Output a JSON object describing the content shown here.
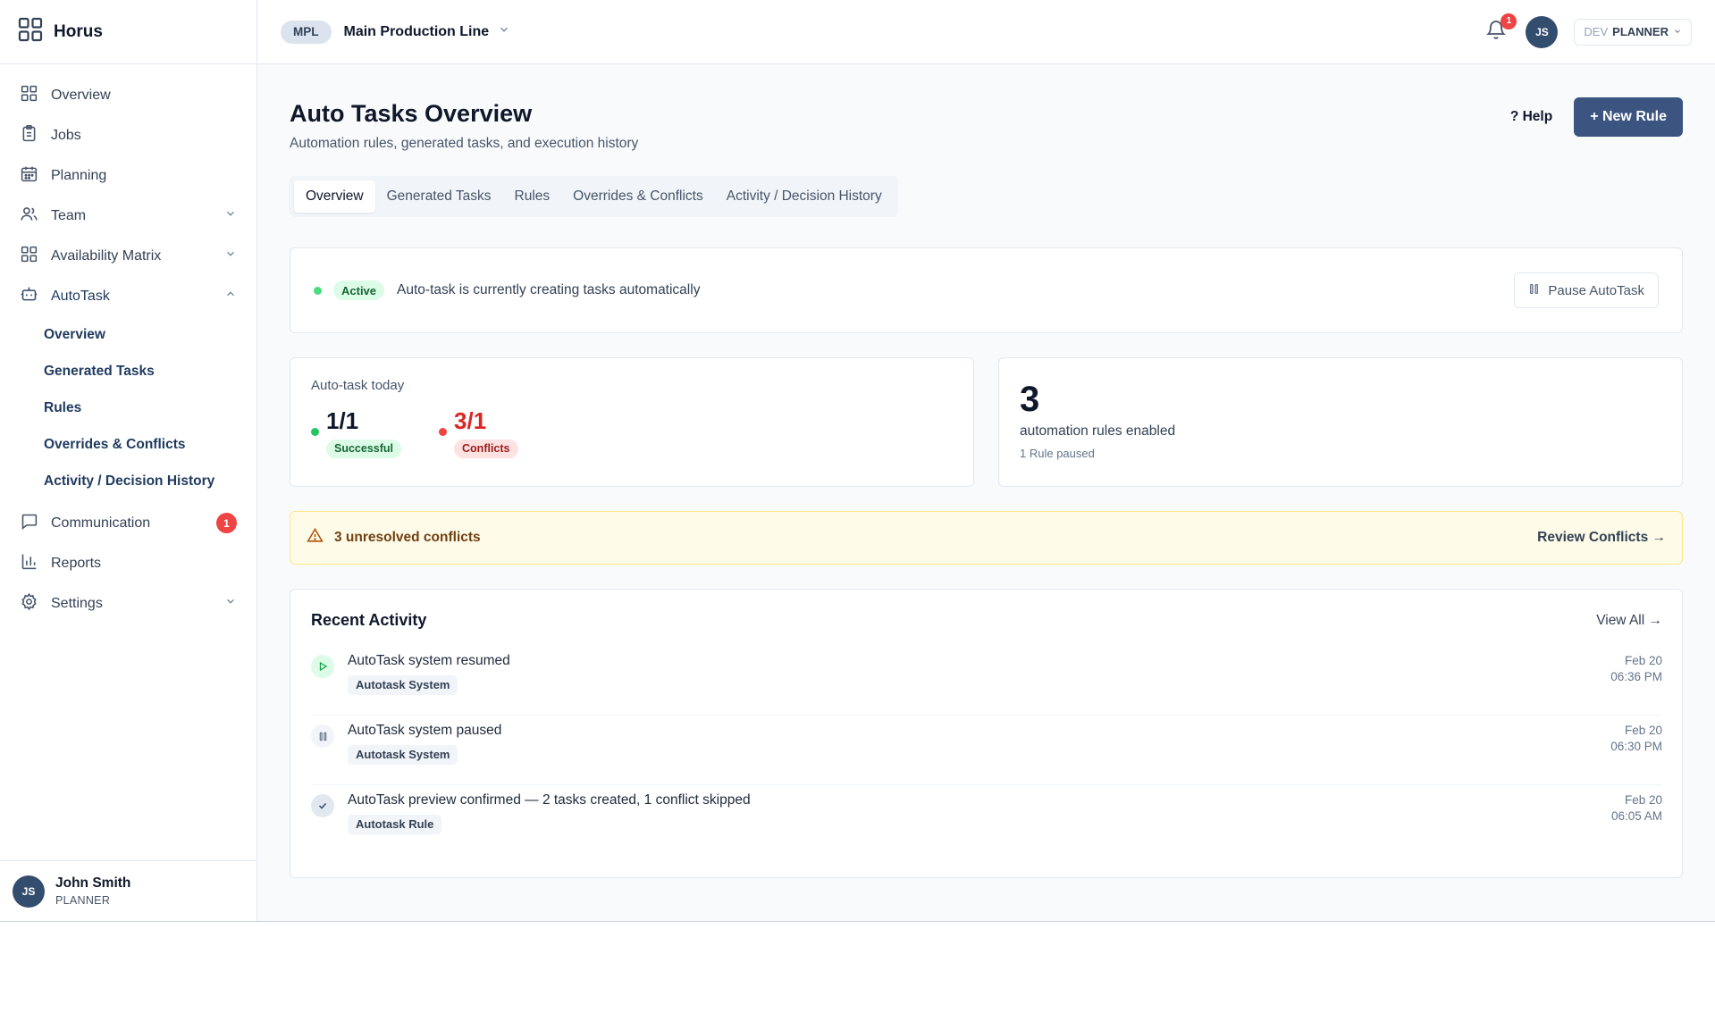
{
  "app": {
    "name": "Horus"
  },
  "sidebar": {
    "items": [
      {
        "label": "Overview"
      },
      {
        "label": "Jobs"
      },
      {
        "label": "Planning"
      },
      {
        "label": "Team"
      },
      {
        "label": "Availability Matrix"
      },
      {
        "label": "AutoTask"
      },
      {
        "label": "Communication",
        "badge": "1"
      },
      {
        "label": "Reports"
      },
      {
        "label": "Settings"
      }
    ],
    "autotask_sub": [
      {
        "label": "Overview"
      },
      {
        "label": "Generated Tasks"
      },
      {
        "label": "Rules"
      },
      {
        "label": "Overrides & Conflicts"
      },
      {
        "label": "Activity / Decision History"
      }
    ],
    "user": {
      "initials": "JS",
      "name": "John Smith",
      "role": "PLANNER"
    }
  },
  "topbar": {
    "line_code": "MPL",
    "line_name": "Main Production Line",
    "notification_count": "1",
    "avatar_initials": "JS",
    "env": "DEV",
    "role": "PLANNER"
  },
  "page": {
    "title": "Auto Tasks Overview",
    "subtitle": "Automation rules, generated tasks, and execution history",
    "help_label": "? Help",
    "new_rule_label": "+ New Rule"
  },
  "tabs": [
    {
      "label": "Overview",
      "active": true
    },
    {
      "label": "Generated Tasks"
    },
    {
      "label": "Rules"
    },
    {
      "label": "Overrides & Conflicts"
    },
    {
      "label": "Activity / Decision History"
    }
  ],
  "status": {
    "badge": "Active",
    "text": "Auto-task is currently creating tasks automatically",
    "pause_label": "Pause AutoTask"
  },
  "stats": {
    "today_label": "Auto-task today",
    "successful_value": "1/1",
    "successful_label": "Successful",
    "conflicts_value": "3/1",
    "conflicts_label": "Conflicts",
    "rules_count": "3",
    "rules_label": "automation rules enabled",
    "rules_sub": "1 Rule paused"
  },
  "alert": {
    "text": "3 unresolved conflicts",
    "link": "Review Conflicts →"
  },
  "activity": {
    "title": "Recent Activity",
    "view_all": "View All →",
    "items": [
      {
        "text": "AutoTask system resumed",
        "tag": "Autotask System",
        "date": "Feb 20",
        "time": "06:36 PM",
        "icon": "play-icon"
      },
      {
        "text": "AutoTask system paused",
        "tag": "Autotask System",
        "date": "Feb 20",
        "time": "06:30 PM",
        "icon": "pause-icon"
      },
      {
        "text": "AutoTask preview confirmed — 2 tasks created, 1 conflict skipped",
        "tag": "Autotask Rule",
        "date": "Feb 20",
        "time": "06:05 AM",
        "icon": "check-icon"
      }
    ]
  },
  "colors": {
    "primary": "#3b5580",
    "success": "#22c55e",
    "danger": "#dc2626",
    "warning_bg": "#fefce8"
  }
}
